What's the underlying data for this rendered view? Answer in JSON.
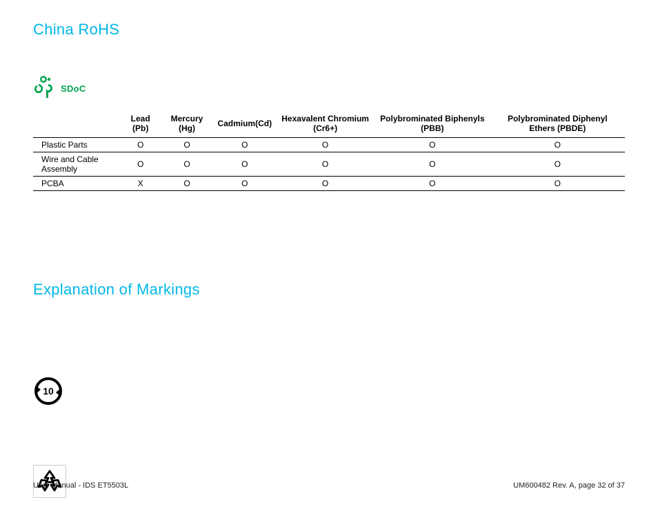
{
  "titles": {
    "china_rohs": "China RoHS",
    "explanation": "Explanation of Markings"
  },
  "sdoc": {
    "label": "SDoC"
  },
  "table": {
    "headers": [
      "",
      "Lead (Pb)",
      "Mercury (Hg)",
      "Cadmium(Cd)",
      "Hexavalent Chromium (Cr6+)",
      "Polybrominated Biphenyls (PBB)",
      "Polybrominated Diphenyl Ethers (PBDE)"
    ],
    "rows": [
      {
        "name": "Plastic Parts",
        "values": [
          "O",
          "O",
          "O",
          "O",
          "O",
          "O"
        ]
      },
      {
        "name": "Wire and Cable Assembly",
        "values": [
          "O",
          "O",
          "O",
          "O",
          "O",
          "O"
        ]
      },
      {
        "name": "PCBA",
        "values": [
          "X",
          "O",
          "O",
          "O",
          "O",
          "O"
        ]
      }
    ]
  },
  "markings": {
    "epup_value": "10"
  },
  "footer": {
    "left": "User Manual - IDS ET5503L",
    "right": "UM600482 Rev. A, page 32 of 37"
  },
  "colors": {
    "heading": "#00b8e6",
    "green": "#00a651"
  }
}
